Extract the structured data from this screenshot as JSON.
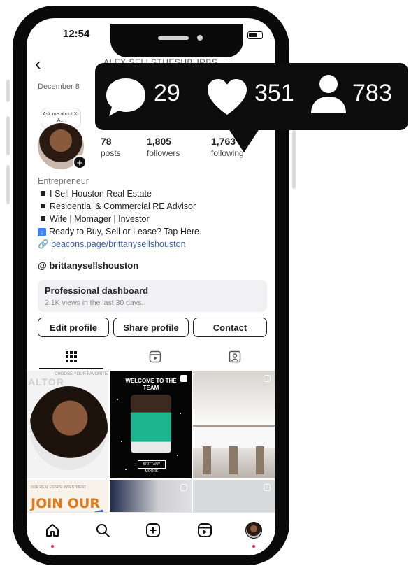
{
  "status_bar": {
    "time": "12:54"
  },
  "header": {
    "username": "ALEX SELLSTHESUBURBS",
    "date": "December 8"
  },
  "profile": {
    "note_bubble": "Ask me about X-A...",
    "stats": [
      {
        "value": "78",
        "label": "posts"
      },
      {
        "value": "1,805",
        "label": "followers"
      },
      {
        "value": "1,763",
        "label": "following"
      }
    ],
    "category": "Entrepreneur",
    "bio_lines": [
      "I Sell Houston Real Estate",
      "Residential & Commercial RE Advisor",
      "Wife | Momager | Investor",
      "Ready to Buy, Sell or Lease? Tap Here."
    ],
    "link": "beacons.page/brittanysellshouston",
    "threads_handle": "brittanysellshouston"
  },
  "dashboard": {
    "title": "Professional dashboard",
    "subtitle": "2.1K views in the last 30 days."
  },
  "actions": {
    "edit": "Edit profile",
    "share": "Share profile",
    "contact": "Contact"
  },
  "grid": {
    "post1": {
      "header": "CHOOSE YOUR FAVORITE",
      "word": "ALTOR"
    },
    "post2": {
      "headline": "WELCOME TO THE TEAM",
      "tag": "BRITTANY MOORE"
    },
    "post4": {
      "header": "OUR REAL ESTATE INVESTMENT",
      "headline": "JOIN OUR VIRTUAL"
    }
  },
  "overlay": {
    "comments": "29",
    "likes": "351",
    "followers": "783"
  }
}
